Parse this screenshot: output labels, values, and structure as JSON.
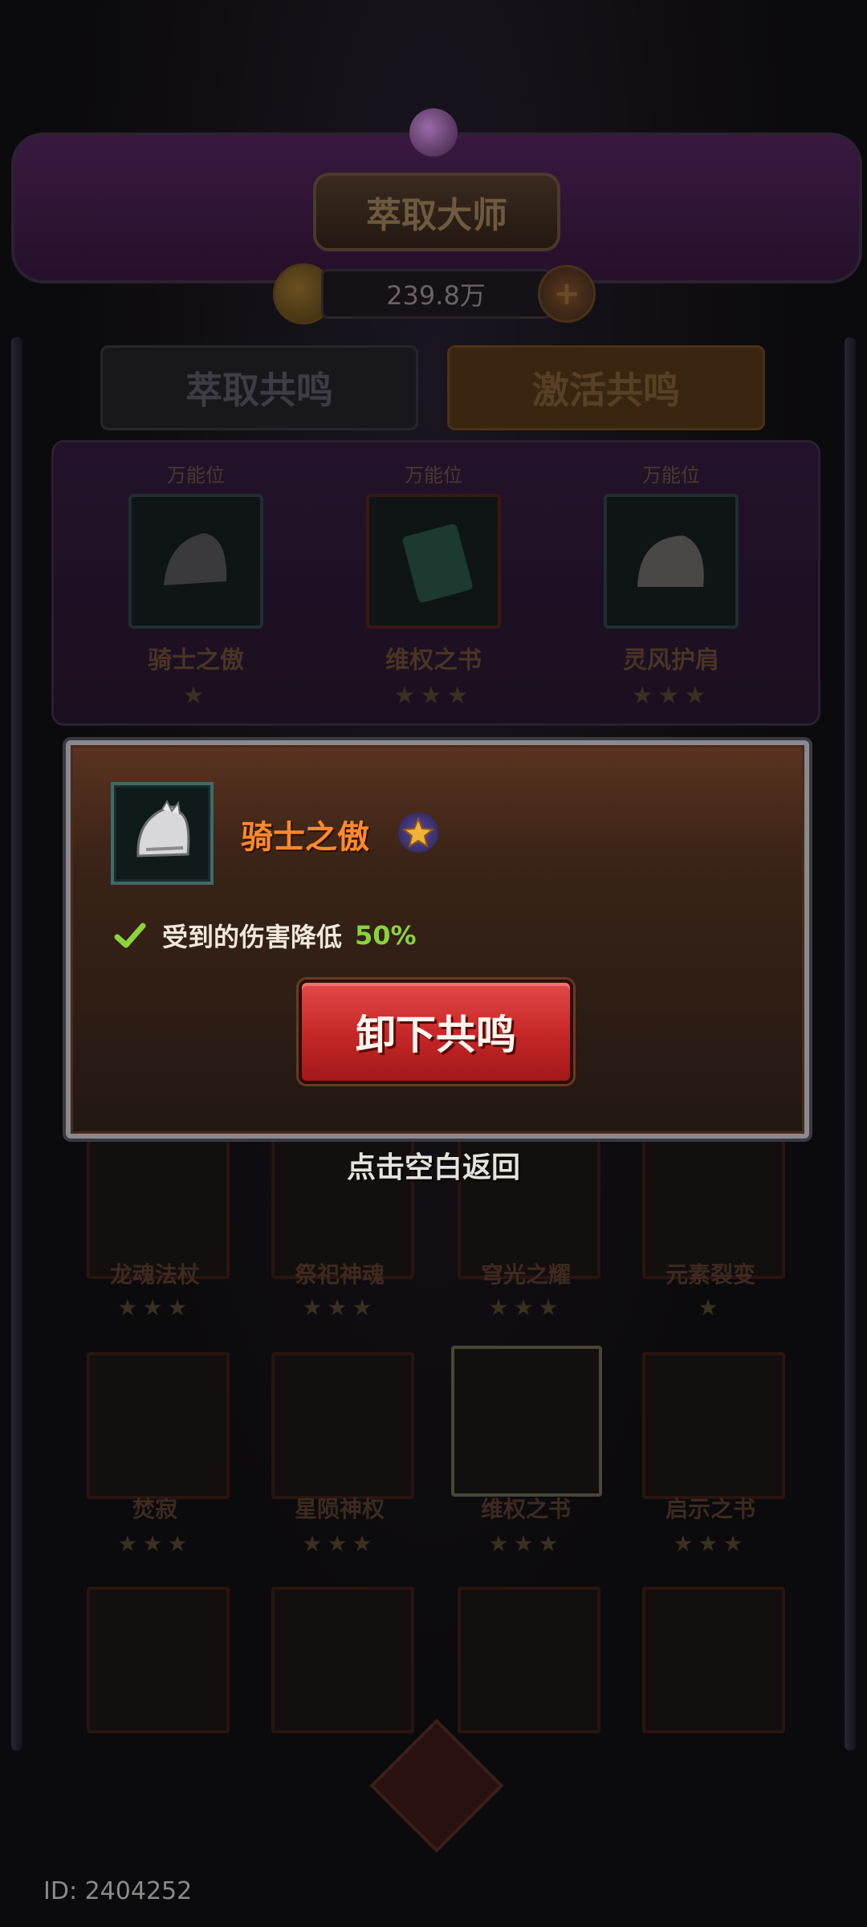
{
  "header": {
    "title": "萃取大师",
    "currency_amount": "239.8万"
  },
  "tabs": [
    {
      "label": "萃取共鸣"
    },
    {
      "label": "激活共鸣"
    }
  ],
  "slots": [
    {
      "tag": "万能位",
      "name": "骑士之傲",
      "stars": "★"
    },
    {
      "tag": "万能位",
      "name": "维权之书",
      "stars": "★★★"
    },
    {
      "tag": "万能位",
      "name": "灵风护肩",
      "stars": "★★★"
    }
  ],
  "grid": [
    {
      "name": "龙魂法杖",
      "stars": "★★★"
    },
    {
      "name": "祭祀神魂",
      "stars": "★★★"
    },
    {
      "name": "穹光之耀",
      "stars": "★★★"
    },
    {
      "name": "元素裂变",
      "stars": "★"
    },
    {
      "name": "焚寂",
      "stars": "★★★"
    },
    {
      "name": "星陨神权",
      "stars": "★★★"
    },
    {
      "name": "维权之书",
      "stars": "★★★"
    },
    {
      "name": "启示之书",
      "stars": "★★★"
    }
  ],
  "popup": {
    "item_name": "骑士之傲",
    "effect_text": "受到的伤害降低",
    "effect_value": "50%",
    "button_label": "卸下共鸣",
    "icons": {
      "item": "knight-helmet-icon",
      "rarity": "star-icon",
      "effect": "check-icon"
    },
    "colors": {
      "title": "#ff8a2a",
      "value": "#8ad43a",
      "button": "#c82828"
    }
  },
  "dismiss_hint": "点击空白返回",
  "footer": {
    "player_id": "ID: 2404252"
  }
}
